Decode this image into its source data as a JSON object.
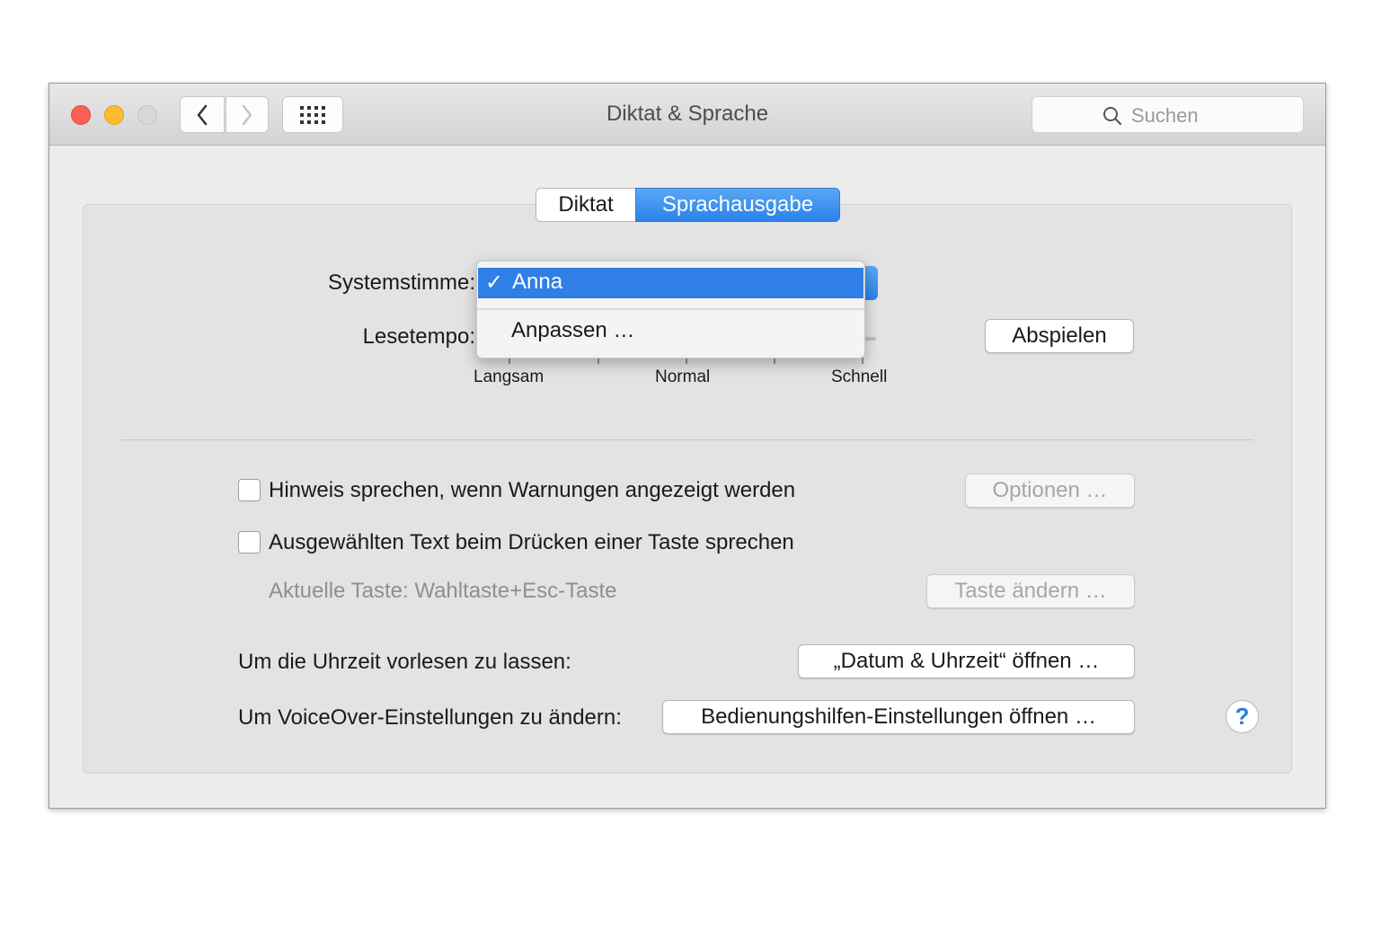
{
  "window": {
    "title": "Diktat & Sprache",
    "search_placeholder": "Suchen"
  },
  "tabs": [
    {
      "label": "Diktat",
      "selected": false
    },
    {
      "label": "Sprachausgabe",
      "selected": true
    }
  ],
  "voice": {
    "label": "Systemstimme:",
    "menu_selected": "Anna",
    "menu_check": "✓",
    "menu_other": "Anpassen …"
  },
  "rate": {
    "label": "Lesetempo:",
    "tick_labels": [
      "Langsam",
      "Normal",
      "Schnell"
    ],
    "play_button": "Abspielen"
  },
  "options": {
    "warn_checkbox": "Hinweis sprechen, wenn Warnungen angezeigt werden",
    "warn_checked": false,
    "warn_button": "Optionen …",
    "select_checkbox": "Ausgewählten Text beim Drücken einer Taste sprechen",
    "select_checked": false,
    "current_key": "Aktuelle Taste: Wahltaste+Esc-Taste",
    "change_key_button": "Taste ändern …",
    "time_label": "Um die Uhrzeit vorlesen zu lassen:",
    "time_button": "„Datum & Uhrzeit“ öffnen …",
    "voiceover_label": "Um VoiceOver-Einstellungen zu ändern:",
    "voiceover_button": "Bedienungshilfen-Einstellungen öffnen …"
  },
  "help_label": "?",
  "colors": {
    "accent": "#2f7fe6",
    "close": "#fc5f57",
    "minimize": "#fdbc2e"
  }
}
